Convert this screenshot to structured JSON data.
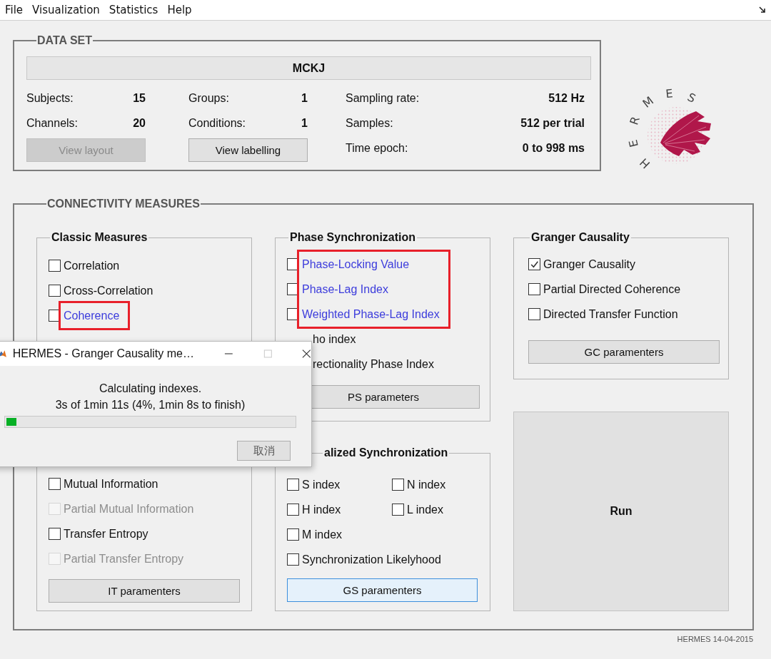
{
  "menu": [
    "File",
    "Visualization",
    "Statistics",
    "Help"
  ],
  "data_set": {
    "title": "DATA SET",
    "name": "MCKJ",
    "columns": [
      {
        "fields": [
          {
            "label": "Subjects:",
            "value": "15"
          },
          {
            "label": "Channels:",
            "value": "20"
          }
        ],
        "button": {
          "label": "View layout",
          "disabled": true
        }
      },
      {
        "fields": [
          {
            "label": "Groups:",
            "value": "1"
          },
          {
            "label": "Conditions:",
            "value": "1"
          }
        ],
        "button": {
          "label": "View labelling",
          "disabled": false
        }
      },
      {
        "fields": [
          {
            "label": "Sampling rate:",
            "value": "512 Hz"
          },
          {
            "label": "Samples:",
            "value": "512 per trial"
          },
          {
            "label": "Time epoch:",
            "value": "0 to 998 ms"
          }
        ]
      }
    ]
  },
  "logo": {
    "letters": [
      "H",
      "E",
      "R",
      "M",
      "E",
      "S"
    ]
  },
  "connectivity": {
    "title": "CONNECTIVITY MEASURES",
    "classic": {
      "title": "Classic Measures",
      "items": [
        {
          "label": "Correlation",
          "kind": "checkbox",
          "checked": false,
          "disabled": false,
          "highlighted": false
        },
        {
          "label": "Cross-Correlation",
          "kind": "checkbox",
          "checked": false,
          "disabled": false,
          "highlighted": false
        },
        {
          "label": "Coherence",
          "kind": "checkbox",
          "checked": false,
          "disabled": false,
          "highlighted": true
        }
      ],
      "lower_items": [
        {
          "label": "Mutual Information",
          "kind": "checkbox",
          "checked": false,
          "disabled": false,
          "highlighted": false
        },
        {
          "label": "Partial Mutual Information",
          "kind": "checkbox",
          "checked": false,
          "disabled": true,
          "highlighted": false
        },
        {
          "label": "Transfer Entropy",
          "kind": "checkbox",
          "checked": false,
          "disabled": false,
          "highlighted": false
        },
        {
          "label": "Partial Transfer Entropy",
          "kind": "checkbox",
          "checked": false,
          "disabled": true,
          "highlighted": false
        }
      ],
      "button": {
        "label": "IT paramenters",
        "focused": false
      }
    },
    "phase": {
      "title": "Phase Synchronization",
      "items": [
        {
          "label": "Phase-Locking Value",
          "kind": "checkbox",
          "checked": false,
          "disabled": false,
          "highlighted": true
        },
        {
          "label": "Phase-Lag Index",
          "kind": "checkbox",
          "checked": false,
          "disabled": false,
          "highlighted": true
        },
        {
          "label": "Weighted Phase-Lag Index",
          "kind": "checkbox",
          "checked": false,
          "disabled": false,
          "highlighted": true
        },
        {
          "label": "ho index",
          "kind": "partial",
          "disabled": false,
          "highlighted": false
        },
        {
          "label": "rectionality Phase Index",
          "kind": "partial",
          "disabled": false,
          "highlighted": false
        }
      ],
      "button": {
        "label": "PS parameters",
        "focused": false
      }
    },
    "generalized": {
      "title": "alized Synchronization",
      "items": [
        {
          "label": "S index",
          "kind": "checkbox",
          "checked": false
        },
        {
          "label": "N index",
          "kind": "checkbox",
          "checked": false
        },
        {
          "label": "H index",
          "kind": "checkbox",
          "checked": false
        },
        {
          "label": "L index",
          "kind": "checkbox",
          "checked": false
        },
        {
          "label": "M index",
          "kind": "checkbox",
          "checked": false
        },
        {
          "label": "Synchronization Likelyhood",
          "kind": "wide",
          "checked": false
        }
      ],
      "button": {
        "label": "GS paramenters",
        "focused": true
      }
    },
    "granger": {
      "title": "Granger Causality",
      "items": [
        {
          "label": "Granger Causality",
          "kind": "checkbox",
          "checked": true,
          "disabled": false,
          "highlighted": false
        },
        {
          "label": "Partial Directed Coherence",
          "kind": "checkbox",
          "checked": false,
          "disabled": false,
          "highlighted": false
        },
        {
          "label": "Directed Transfer Function",
          "kind": "checkbox",
          "checked": false,
          "disabled": false,
          "highlighted": false
        }
      ],
      "button": {
        "label": "GC paramenters",
        "focused": false
      }
    },
    "run_button": "Run"
  },
  "footer": "HERMES 14-04-2015",
  "dialog": {
    "title": "HERMES - Granger Causality me…",
    "message": "Calculating indexes.",
    "progress_text": "3s of 1min 11s (4%, 1min 8s to finish)",
    "progress": {
      "level": 0.035
    },
    "cancel_button": "取消"
  }
}
